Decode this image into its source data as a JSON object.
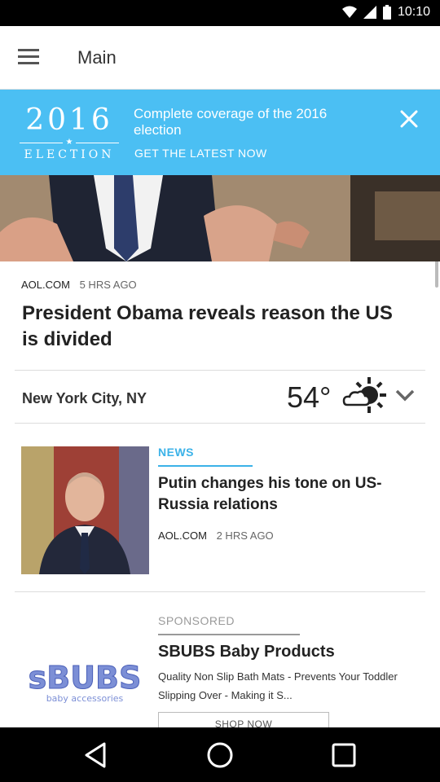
{
  "status_bar": {
    "time": "10:10",
    "icons": [
      "wifi-icon",
      "cellular-icon",
      "battery-icon"
    ]
  },
  "app_bar": {
    "title": "Main",
    "menu_icon": "hamburger-menu-icon"
  },
  "election_banner": {
    "logo_year": "2016",
    "logo_star": "★",
    "logo_word": "ELECTION",
    "text": "Complete coverage of the 2016 election",
    "cta": "GET THE LATEST NOW",
    "close_icon": "close-icon",
    "background_color": "#4bbff3"
  },
  "top_story": {
    "source": "AOL.COM",
    "time": "5 HRS AGO",
    "headline": "President Obama reveals reason the US is divided"
  },
  "weather": {
    "city": "New York City, NY",
    "temperature": "54°",
    "condition_icon": "partly-sunny-icon",
    "expand_icon": "chevron-down-icon"
  },
  "news_story": {
    "category": "NEWS",
    "headline": "Putin changes his tone on US-Russia relations",
    "source": "AOL.COM",
    "time": "2 HRS AGO",
    "accent_color": "#3bb2e8"
  },
  "sponsored": {
    "label": "SPONSORED",
    "logo_text": "sBUBS",
    "logo_sub": "baby accessories",
    "title": "SBUBS Baby Products",
    "description": "Quality Non Slip Bath Mats - Prevents Your Toddler Slipping Over - Making it S...",
    "button": "SHOP NOW"
  },
  "nav_bar": {
    "icons": [
      "back-icon",
      "home-icon",
      "recents-icon"
    ]
  }
}
